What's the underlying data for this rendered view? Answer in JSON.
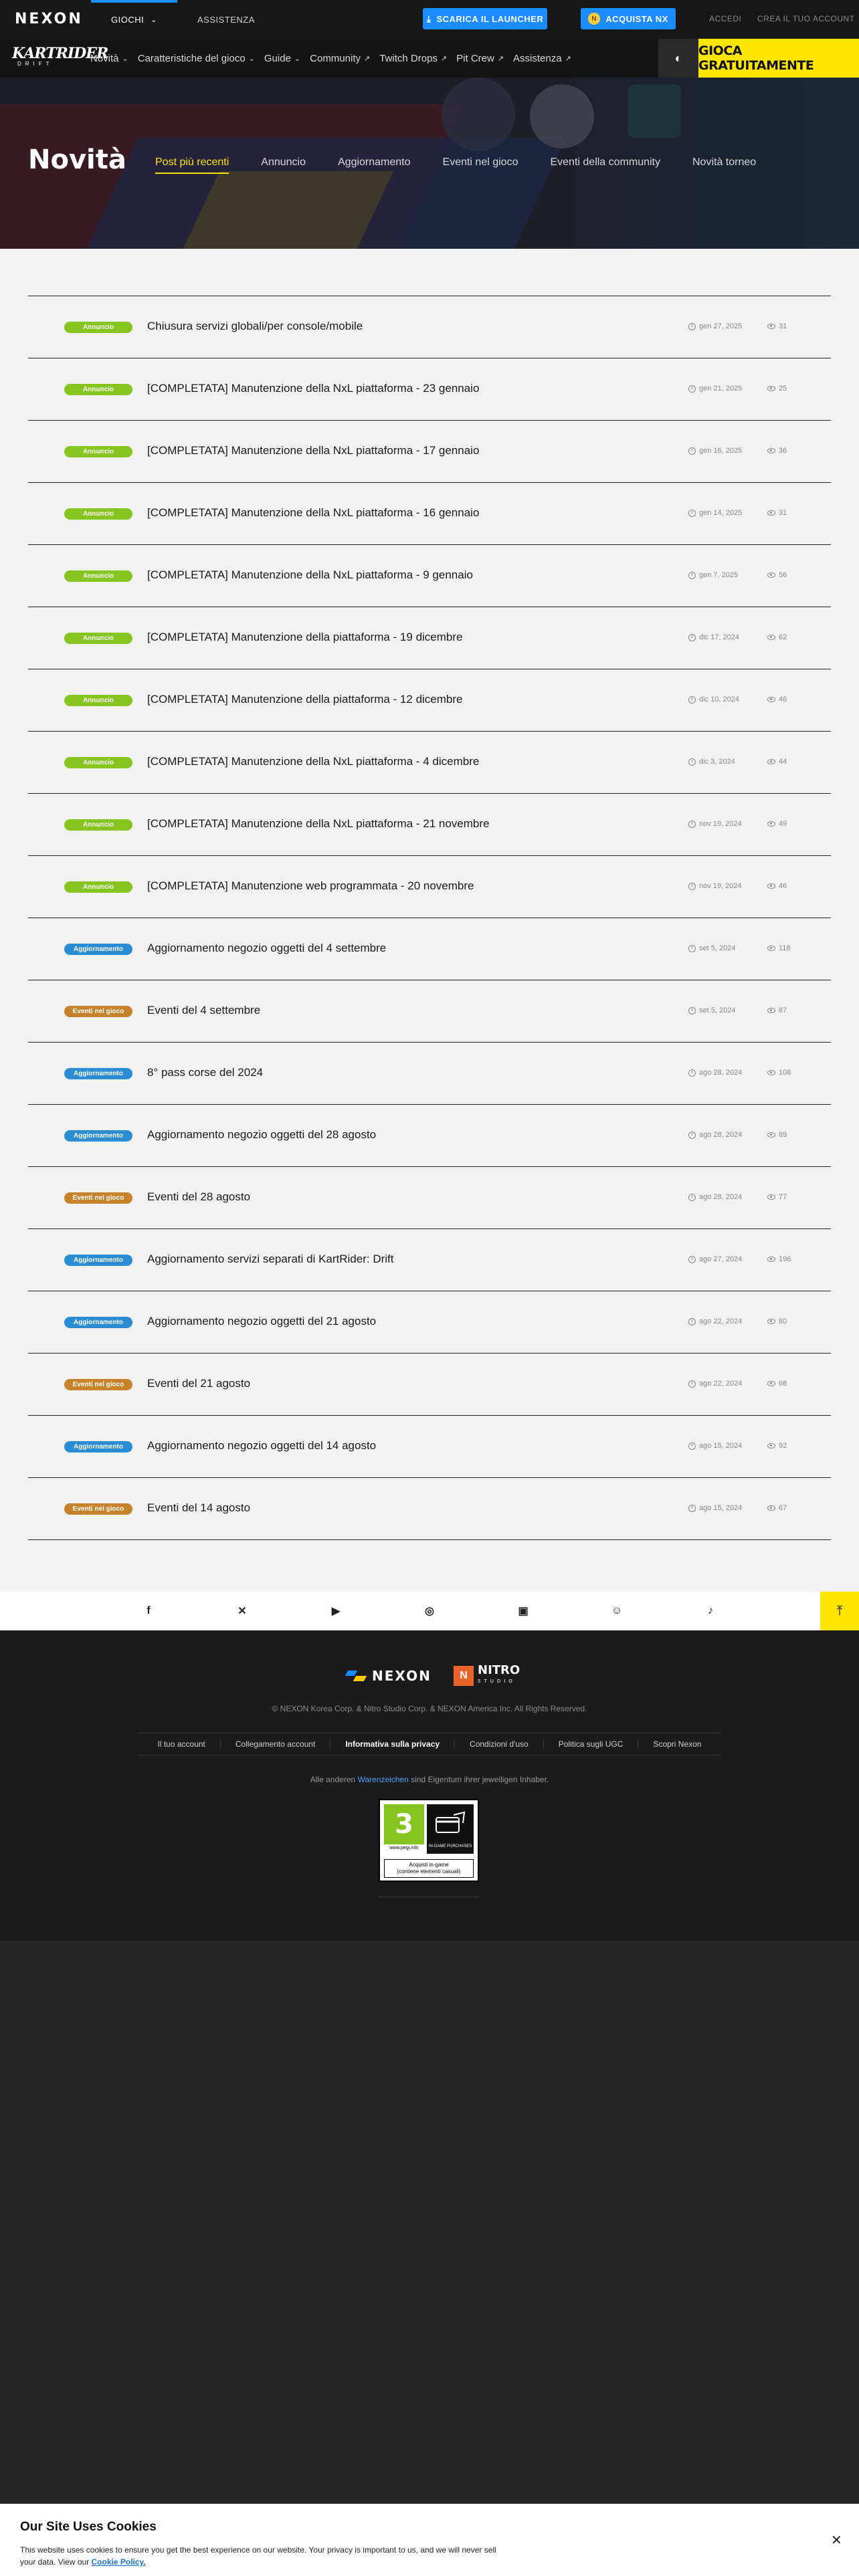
{
  "topbar": {
    "logo": "NEXON",
    "nav": [
      {
        "label": "GIOCHI",
        "active": true
      },
      {
        "label": "ASSISTENZA",
        "active": false
      }
    ],
    "launcher_label": "SCARICA IL LAUNCHER",
    "nx_label": "ACQUISTA NX",
    "login_label": "ACCEDI",
    "create_label": "CREA IL TUO ACCOUNT"
  },
  "gamenav": {
    "logo_main": "KARTRIDER",
    "logo_sub": "DRIFT",
    "items": [
      {
        "label": "Novità",
        "icon": "chevron-down-icon"
      },
      {
        "label": "Caratteristiche del gioco",
        "icon": "chevron-down-icon"
      },
      {
        "label": "Guide",
        "icon": "chevron-down-icon"
      },
      {
        "label": "Community",
        "icon": "external-link-icon"
      },
      {
        "label": "Twitch Drops",
        "icon": "external-link-icon"
      },
      {
        "label": "Pit Crew",
        "icon": "external-link-icon"
      },
      {
        "label": "Assistenza",
        "icon": "external-link-icon"
      }
    ],
    "play_label": "GIOCA GRATUITAMENTE"
  },
  "hero": {
    "title": "Novità",
    "tabs": [
      {
        "label": "Post più recenti",
        "active": true
      },
      {
        "label": "Annuncio",
        "active": false
      },
      {
        "label": "Aggiornamento",
        "active": false
      },
      {
        "label": "Eventi nel gioco",
        "active": false
      },
      {
        "label": "Eventi della community",
        "active": false
      },
      {
        "label": "Novità torneo",
        "active": false
      }
    ]
  },
  "posts": [
    {
      "badge": "Annuncio",
      "kind": "ann",
      "title": "Chiusura servizi globali/per console/mobile",
      "date": "gen 27, 2025",
      "views": "31"
    },
    {
      "badge": "Annuncio",
      "kind": "ann",
      "title": "[COMPLETATA] Manutenzione della NxL piattaforma - 23 gennaio",
      "date": "gen 21, 2025",
      "views": "25"
    },
    {
      "badge": "Annuncio",
      "kind": "ann",
      "title": "[COMPLETATA] Manutenzione della NxL piattaforma - 17 gennaio",
      "date": "gen 16, 2025",
      "views": "36"
    },
    {
      "badge": "Annuncio",
      "kind": "ann",
      "title": "[COMPLETATA] Manutenzione della NxL piattaforma - 16 gennaio",
      "date": "gen 14, 2025",
      "views": "31"
    },
    {
      "badge": "Annuncio",
      "kind": "ann",
      "title": "[COMPLETATA] Manutenzione della NxL piattaforma - 9 gennaio",
      "date": "gen 7, 2025",
      "views": "56"
    },
    {
      "badge": "Annuncio",
      "kind": "ann",
      "title": "[COMPLETATA] Manutenzione della piattaforma - 19 dicembre",
      "date": "dic 17, 2024",
      "views": "62"
    },
    {
      "badge": "Annuncio",
      "kind": "ann",
      "title": "[COMPLETATA] Manutenzione della piattaforma - 12 dicembre",
      "date": "dic 10, 2024",
      "views": "46"
    },
    {
      "badge": "Annuncio",
      "kind": "ann",
      "title": "[COMPLETATA] Manutenzione della NxL piattaforma - 4 dicembre",
      "date": "dic 3, 2024",
      "views": "44"
    },
    {
      "badge": "Annuncio",
      "kind": "ann",
      "title": "[COMPLETATA] Manutenzione della NxL piattaforma - 21 novembre",
      "date": "nov 19, 2024",
      "views": "49"
    },
    {
      "badge": "Annuncio",
      "kind": "ann",
      "title": "[COMPLETATA] Manutenzione web programmata - 20 novembre",
      "date": "nov 19, 2024",
      "views": "46"
    },
    {
      "badge": "Aggiornamento",
      "kind": "upd",
      "title": "Aggiornamento negozio oggetti del 4 settembre",
      "date": "set 5, 2024",
      "views": "118"
    },
    {
      "badge": "Eventi nel gioco",
      "kind": "evt",
      "title": "Eventi del 4 settembre",
      "date": "set 5, 2024",
      "views": "87"
    },
    {
      "badge": "Aggiornamento",
      "kind": "upd",
      "title": "8° pass corse del 2024",
      "date": "ago 28, 2024",
      "views": "108"
    },
    {
      "badge": "Aggiornamento",
      "kind": "upd",
      "title": "Aggiornamento negozio oggetti del 28 agosto",
      "date": "ago 28, 2024",
      "views": "89"
    },
    {
      "badge": "Eventi nel gioco",
      "kind": "evt",
      "title": "Eventi del 28 agosto",
      "date": "ago 28, 2024",
      "views": "77"
    },
    {
      "badge": "Aggiornamento",
      "kind": "upd",
      "title": "Aggiornamento servizi separati di KartRider: Drift",
      "date": "ago 27, 2024",
      "views": "196"
    },
    {
      "badge": "Aggiornamento",
      "kind": "upd",
      "title": "Aggiornamento negozio oggetti del 21 agosto",
      "date": "ago 22, 2024",
      "views": "80"
    },
    {
      "badge": "Eventi nel gioco",
      "kind": "evt",
      "title": "Eventi del 21 agosto",
      "date": "ago 22, 2024",
      "views": "68"
    },
    {
      "badge": "Aggiornamento",
      "kind": "upd",
      "title": "Aggiornamento negozio oggetti del 14 agosto",
      "date": "ago 15, 2024",
      "views": "92"
    },
    {
      "badge": "Eventi nel gioco",
      "kind": "evt",
      "title": "Eventi del 14 agosto",
      "date": "ago 15, 2024",
      "views": "67"
    }
  ],
  "social": [
    "facebook-icon",
    "x-icon",
    "youtube-icon",
    "instagram-icon",
    "twitch-icon",
    "discord-icon",
    "tiktok-icon"
  ],
  "footer": {
    "nexon_logo": "NEXON",
    "nitro_logo": "NITRO",
    "nitro_sub": "STUDIO",
    "copyright": "© NEXON Korea Corp. & Nitro Studio Corp. & NEXON America Inc. All Rights Reserved.",
    "links": [
      {
        "label": "Il tuo account",
        "bold": false
      },
      {
        "label": "Collegamento account",
        "bold": false
      },
      {
        "label": "Informativa sulla privacy",
        "bold": true
      },
      {
        "label": "Condizioni d'uso",
        "bold": false
      },
      {
        "label": "Politica sugli UGC",
        "bold": false
      },
      {
        "label": "Scopri Nexon",
        "bold": false
      }
    ],
    "trademark_before": "Alle anderen",
    "trademark_link": "Warenzeichen",
    "trademark_after": "sind Eigentum ihrer jeweiligen Inhaber.",
    "pegi_rating": "3",
    "pegi_url": "www.pegi.info",
    "pegi_purchases": "IN-GAME PURCHASES",
    "pegi_caption_1": "Acquisti in-game",
    "pegi_caption_2": "(contiene elementi casuali)"
  },
  "cookie": {
    "title": "Our Site Uses Cookies",
    "text": "This website uses cookies to ensure you get the best experience on our website. Your privacy is important to us, and we will never sell your data. View our",
    "policy_link": "Cookie Policy."
  },
  "colors": {
    "accent_blue": "#1a8cff",
    "accent_yellow": "#ffe600",
    "badge_announcement": "#86c51f",
    "badge_update": "#2a8dd4",
    "badge_event": "#c7822a"
  }
}
